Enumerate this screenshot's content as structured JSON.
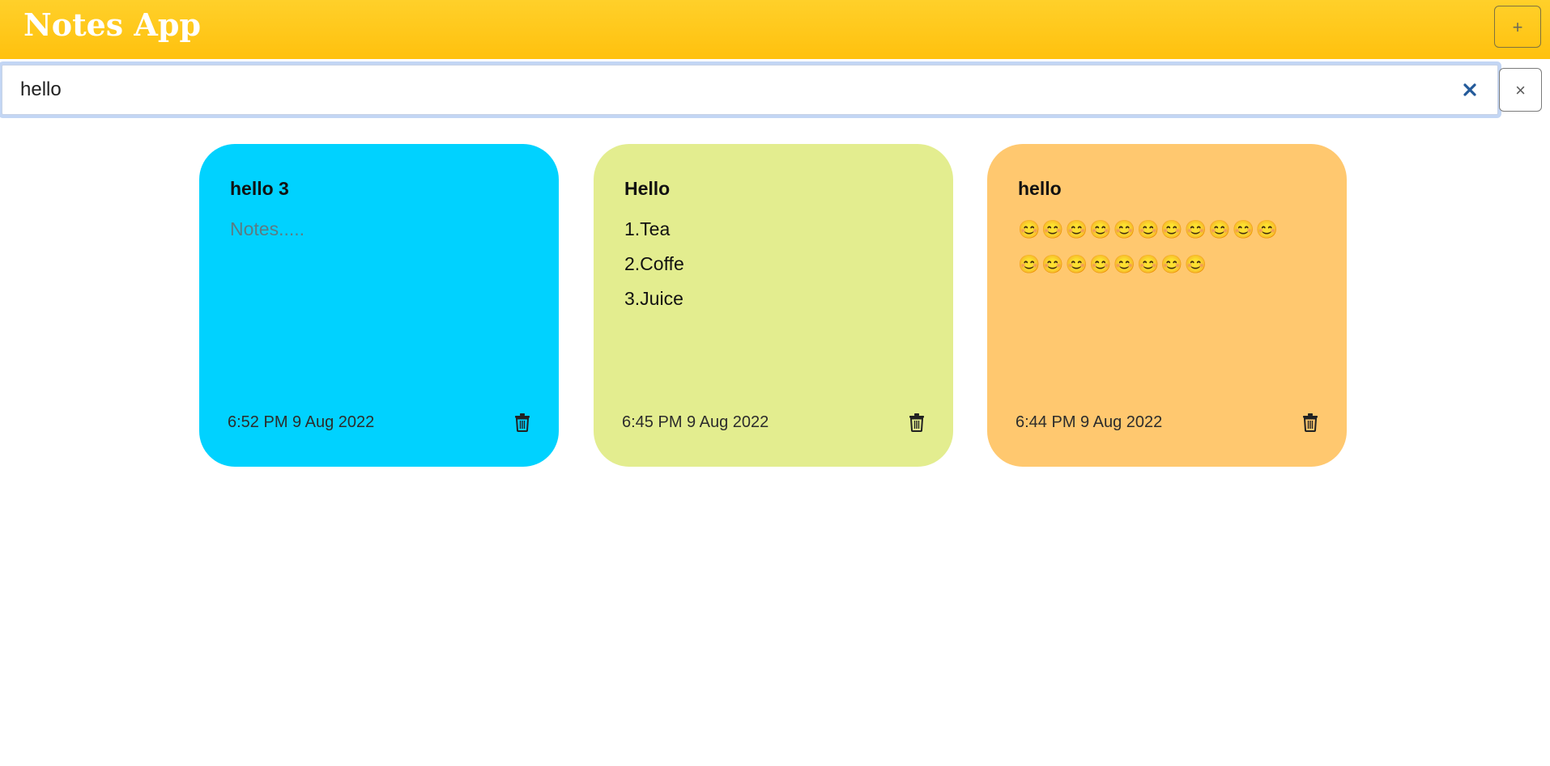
{
  "app": {
    "title": "Notes App",
    "add_label": "+"
  },
  "search": {
    "value": "hello",
    "close_label": "×"
  },
  "colors": {
    "topbar": "#ffc613",
    "note1": "#00d2ff",
    "note2": "#e3ed8f",
    "note3": "#ffc86f"
  },
  "notes": [
    {
      "title": "hello 3",
      "body": "Notes.....",
      "date": "6:52 PM 9 Aug 2022"
    },
    {
      "title": "Hello",
      "body": "1.Tea\n2.Coffe\n3.Juice",
      "date": "6:45 PM 9 Aug 2022"
    },
    {
      "title": "hello",
      "body": "😊😊😊😊😊😊😊😊😊😊😊\n😊😊😊😊😊😊😊😊",
      "date": "6:44 PM 9 Aug 2022"
    }
  ]
}
